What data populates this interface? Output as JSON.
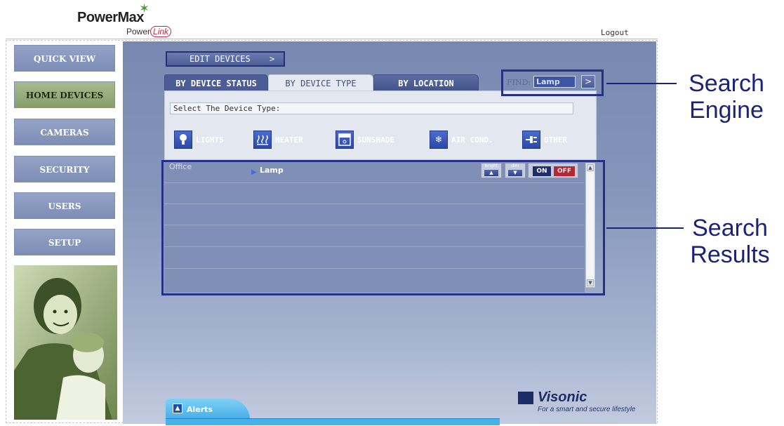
{
  "header": {
    "brand": "PowerMax",
    "sub_brand_prefix": "Power",
    "sub_brand_link": "Link",
    "logout": "Logout"
  },
  "sidebar": {
    "items": [
      {
        "label": "QUICK VIEW",
        "active": false
      },
      {
        "label": "HOME DEVICES",
        "active": true
      },
      {
        "label": "CAMERAS",
        "active": false
      },
      {
        "label": "SECURITY",
        "active": false
      },
      {
        "label": "USERS",
        "active": false
      },
      {
        "label": "SETUP",
        "active": false
      }
    ]
  },
  "toolbar": {
    "edit_devices": "EDIT DEVICES",
    "edit_devices_icon": "chevron-right-icon"
  },
  "tabs": [
    {
      "label": "BY DEVICE STATUS",
      "selected": false
    },
    {
      "label": "BY DEVICE TYPE",
      "selected": true
    },
    {
      "label": "BY LOCATION",
      "selected": false
    }
  ],
  "find": {
    "label": "FIND:",
    "value": "Lamp"
  },
  "device_type": {
    "prompt": "Select The Device Type:",
    "types": [
      {
        "label": "LIGHTS",
        "icon": "bulb-icon"
      },
      {
        "label": "HEATER",
        "icon": "heater-icon"
      },
      {
        "label": "SUNSHADE",
        "icon": "sunshade-icon"
      },
      {
        "label": "AIR COND.",
        "icon": "snowflake-icon"
      },
      {
        "label": "OTHER",
        "icon": "plug-icon"
      }
    ]
  },
  "results": {
    "rows": [
      {
        "location": "Office",
        "device": "Lamp",
        "bright_label": "bright",
        "dim_label": "dim",
        "on_label": "ON",
        "off_label": "OFF",
        "state": "OFF"
      }
    ]
  },
  "annotations": {
    "search_engine": [
      "Search",
      "Engine"
    ],
    "search_results": [
      "Search",
      "Results"
    ]
  },
  "footer": {
    "alerts": "Alerts",
    "visonic": "Visonic",
    "tagline": "For a smart and secure lifestyle"
  },
  "colors": {
    "accent_blue": "#4c5d95",
    "annotation": "#1b2379",
    "off_red": "#b02a36",
    "active_nav_green": "#879e6b"
  }
}
